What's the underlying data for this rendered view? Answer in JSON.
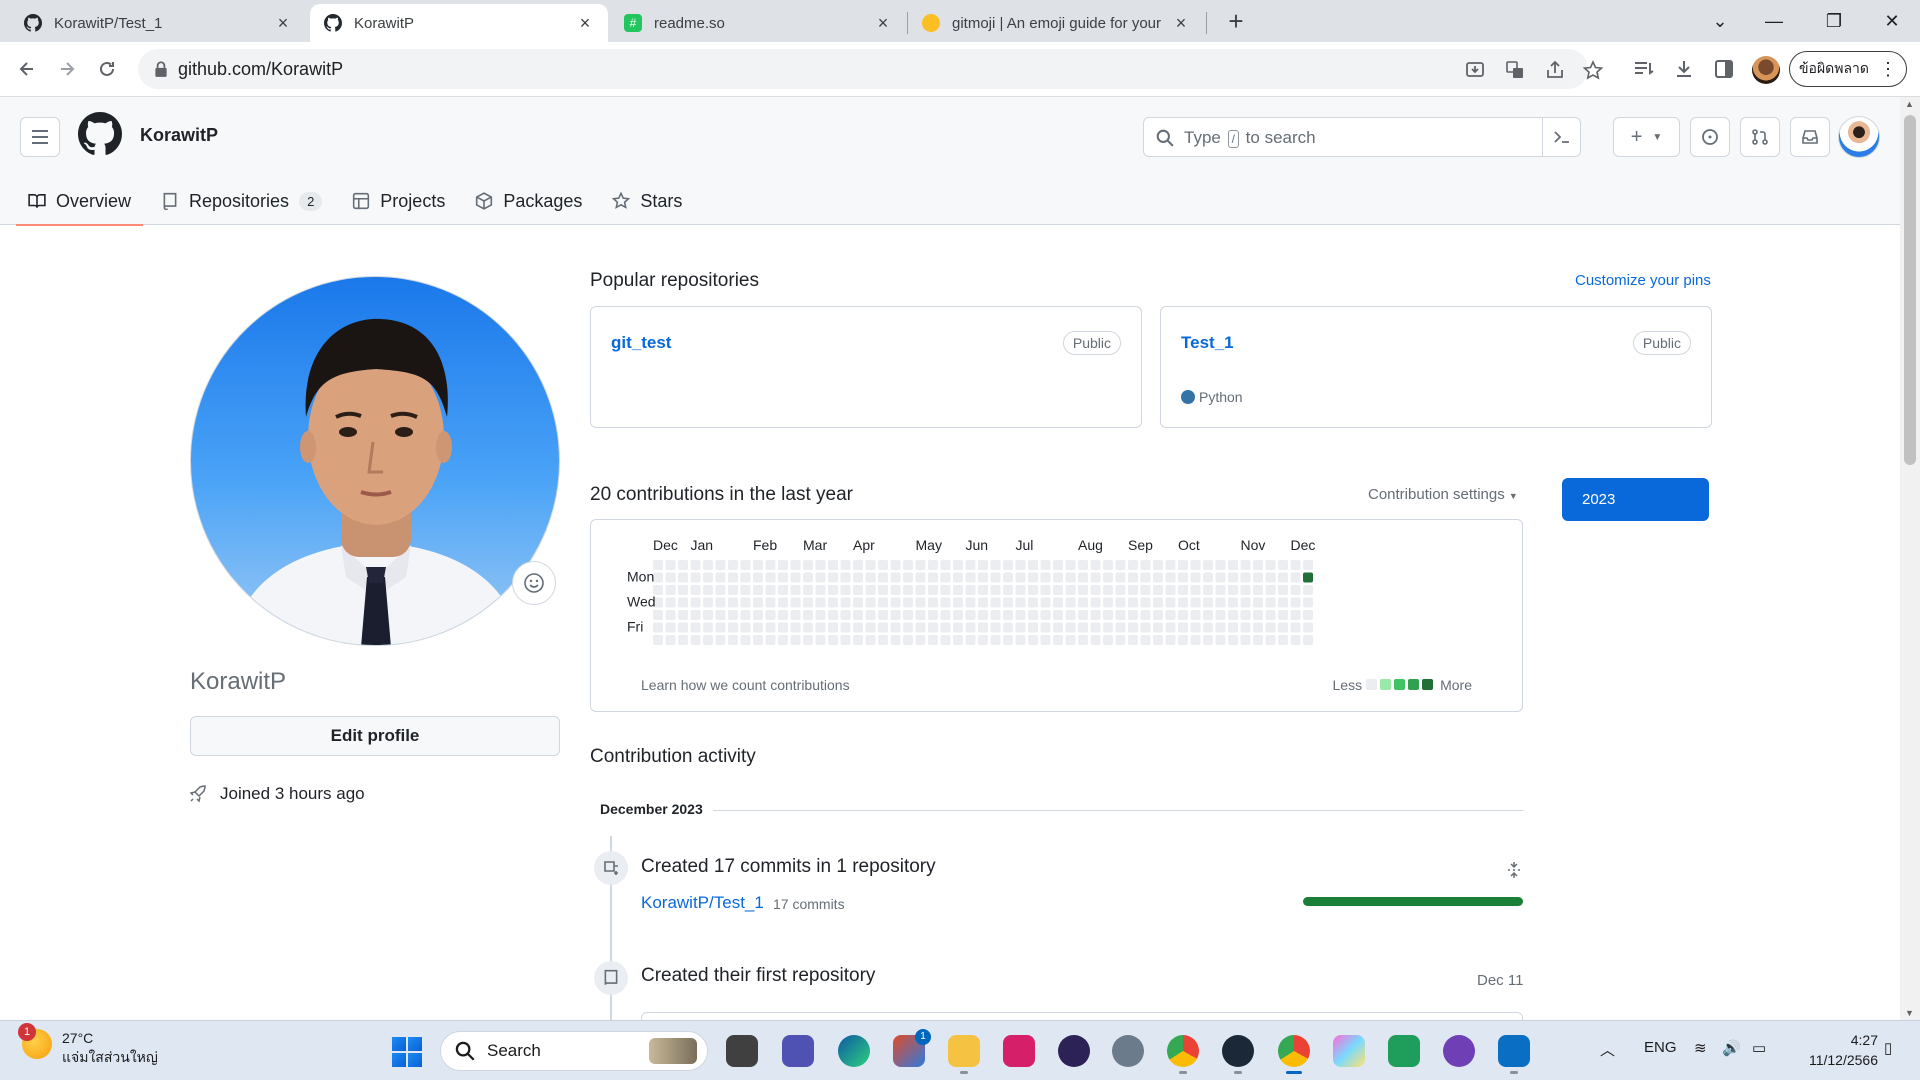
{
  "browser": {
    "tabs": [
      {
        "title": "KorawitP/Test_1",
        "icon": "github-icon",
        "active": false
      },
      {
        "title": "KorawitP",
        "icon": "github-icon",
        "active": true
      },
      {
        "title": "readme.so",
        "icon": "readme-icon",
        "active": false
      },
      {
        "title": "gitmoji | An emoji guide for your",
        "icon": "gitmoji-icon",
        "active": false
      }
    ],
    "url": "github.com/KorawitP",
    "error_button": "ข้อผิดพลาด"
  },
  "github": {
    "username": "KorawitP",
    "search_placeholder_pre": "Type",
    "search_placeholder_key": "/",
    "search_placeholder_post": "to search",
    "nav_tabs": [
      {
        "label": "Overview",
        "icon": "book-icon",
        "active": true
      },
      {
        "label": "Repositories",
        "icon": "repo-icon",
        "count": "2"
      },
      {
        "label": "Projects",
        "icon": "table-icon"
      },
      {
        "label": "Packages",
        "icon": "package-icon"
      },
      {
        "label": "Stars",
        "icon": "star-icon"
      }
    ]
  },
  "profile": {
    "display_name": "KorawitP",
    "edit_button": "Edit profile",
    "joined": "Joined 3 hours ago"
  },
  "popular": {
    "heading": "Popular repositories",
    "customize": "Customize your pins",
    "repos": [
      {
        "name": "git_test",
        "visibility": "Public",
        "language": ""
      },
      {
        "name": "Test_1",
        "visibility": "Public",
        "language": "Python",
        "language_color": "#3572A5"
      }
    ]
  },
  "contributions": {
    "heading": "20 contributions in the last year",
    "settings": "Contribution settings",
    "year_button": "2023",
    "months": [
      "Dec",
      "Jan",
      "Feb",
      "Mar",
      "Apr",
      "May",
      "Jun",
      "Jul",
      "Aug",
      "Sep",
      "Oct",
      "Nov",
      "Dec"
    ],
    "day_labels": [
      "Mon",
      "Wed",
      "Fri"
    ],
    "learn": "Learn how we count contributions",
    "legend_less": "Less",
    "legend_more": "More",
    "legend_colors": [
      "#ebedf0",
      "#9be9a8",
      "#40c463",
      "#30a14e",
      "#216e39"
    ],
    "active_cell": {
      "week": 52,
      "day": "Mon",
      "color": "#216e39"
    }
  },
  "activity": {
    "heading": "Contribution activity",
    "month": "December 2023",
    "items": [
      {
        "title": "Created 17 commits in 1 repository",
        "repo": "KorawitP/Test_1",
        "sub": "17 commits",
        "progress": 1.0
      },
      {
        "title": "Created their first repository",
        "date": "Dec 11"
      }
    ]
  },
  "taskbar": {
    "temperature": "27°C",
    "weather_text": "แจ่มใสส่วนใหญ่",
    "weather_badge": "1",
    "search": "Search",
    "store_badge": "1",
    "lang": "ENG",
    "time": "4:27",
    "date": "11/12/2566"
  }
}
